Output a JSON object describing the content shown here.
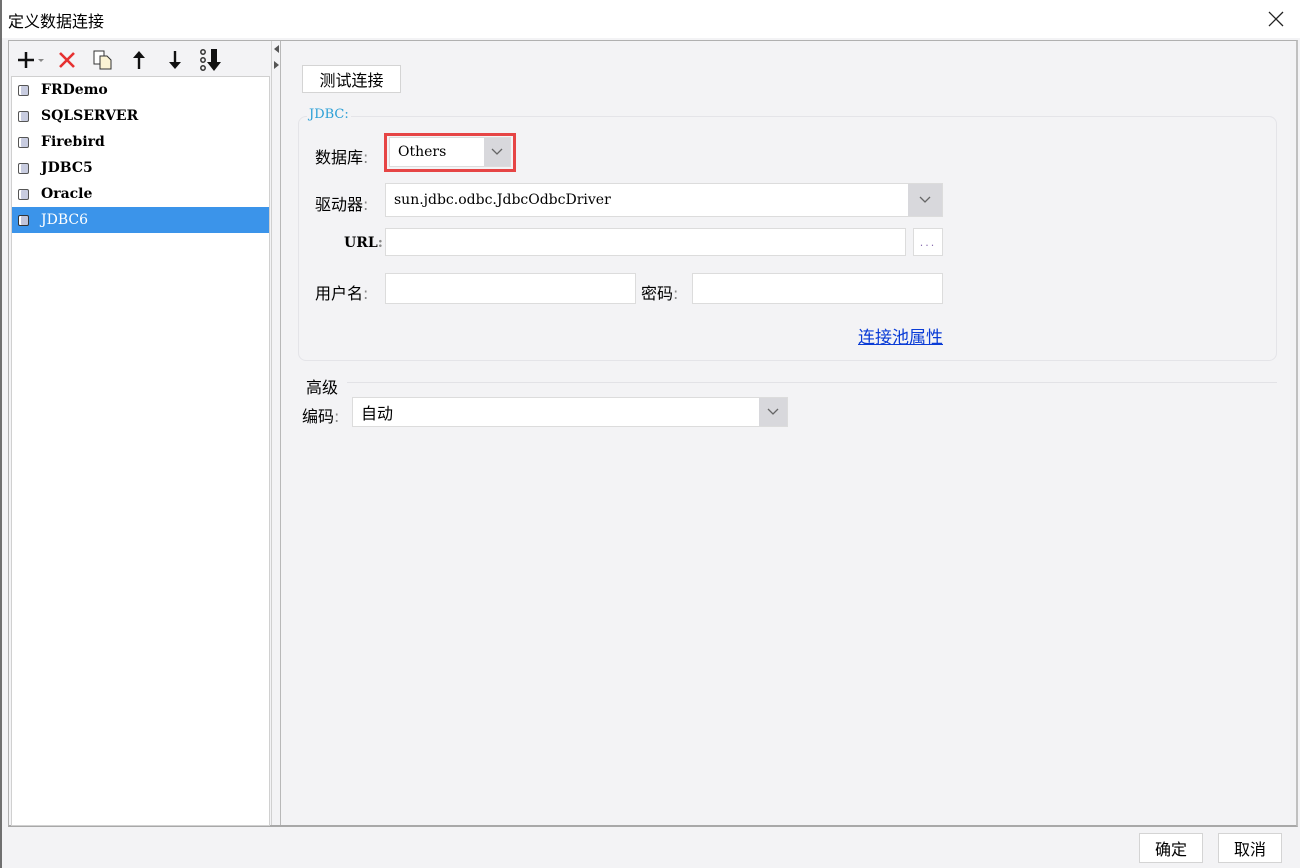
{
  "window": {
    "title": "定义数据连接",
    "close_icon": "close-icon"
  },
  "toolbar": {
    "buttons": [
      {
        "name": "add",
        "icon": "plus-icon"
      },
      {
        "name": "delete",
        "icon": "red-x-icon"
      },
      {
        "name": "copy",
        "icon": "copy-icon"
      },
      {
        "name": "move-up",
        "icon": "arrow-up-icon"
      },
      {
        "name": "move-down",
        "icon": "arrow-down-icon"
      },
      {
        "name": "sort",
        "icon": "sort-down-icon"
      }
    ]
  },
  "connections": {
    "items": [
      {
        "label": "FRDemo",
        "selected": false
      },
      {
        "label": "SQLSERVER",
        "selected": false
      },
      {
        "label": "Firebird",
        "selected": false
      },
      {
        "label": "JDBC5",
        "selected": false
      },
      {
        "label": "Oracle",
        "selected": false
      },
      {
        "label": "JDBC6",
        "selected": true
      }
    ]
  },
  "main": {
    "test_button": "测试连接",
    "group_title": "JDBC:",
    "database_label": "数据库",
    "database_value": "Others",
    "driver_label": "驱动器",
    "driver_value": "sun.jdbc.odbc.JdbcOdbcDriver",
    "url_label": "URL",
    "url_value": "",
    "url_browse": "...",
    "username_label": "用户名",
    "username_value": "",
    "password_label": "密码",
    "password_value": "",
    "pool_link": "连接池属性",
    "advanced_title": "高级",
    "encoding_label": "编码",
    "encoding_value": "自动",
    "colon": ":"
  },
  "footer": {
    "ok": "确定",
    "cancel": "取消"
  },
  "colors": {
    "selection": "#3b94ea",
    "highlight": "#e64545",
    "link": "#0a3cd6",
    "legend": "#2a9fd6"
  }
}
